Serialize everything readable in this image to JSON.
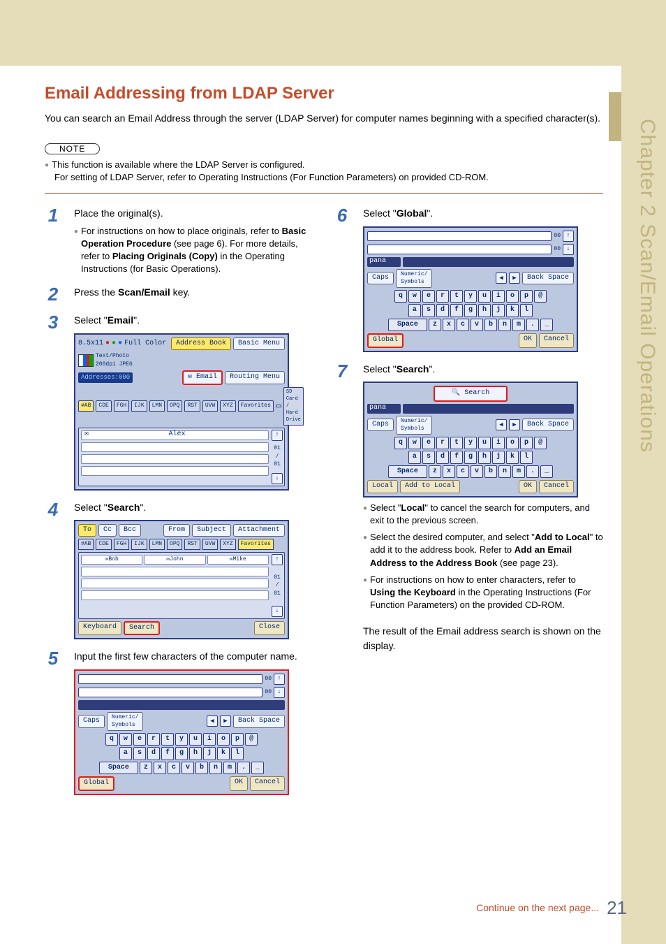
{
  "sidebar": {
    "chapter_label": "Chapter 2  Scan/Email Operations"
  },
  "header": {
    "title": "Email Addressing from LDAP Server",
    "intro": "You can search an Email Address through the server (LDAP Server) for computer names beginning with a specified character(s)."
  },
  "note": {
    "label": "NOTE",
    "items": [
      "This function is available where the LDAP Server is configured.",
      "For setting of LDAP Server, refer to Operating Instructions (For Function Parameters) on provided CD-ROM."
    ]
  },
  "steps": {
    "s1": {
      "text": "Place the original(s).",
      "sub": "For instructions on how to place originals, refer to ",
      "sub_b1": "Basic Operation Procedure",
      "sub_mid": " (see page 6). For more details, refer to ",
      "sub_b2": "Placing Originals (Copy)",
      "sub_end": " in the Operating Instructions (for Basic Operations)."
    },
    "s2": {
      "pre": "Press the ",
      "bold": "Scan/Email",
      "post": " key."
    },
    "s3": {
      "pre": "Select \"",
      "bold": "Email",
      "post": "\"."
    },
    "s4": {
      "pre": "Select \"",
      "bold": "Search",
      "post": "\"."
    },
    "s5": {
      "text": "Input the first few characters of the computer name."
    },
    "s6": {
      "pre": "Select \"",
      "bold": "Global",
      "post": "\"."
    },
    "s7": {
      "pre": "Select \"",
      "bold": "Search",
      "post": "\"."
    },
    "s7_subs": {
      "a_pre": "Select \"",
      "a_b": "Local",
      "a_post": "\" to cancel the search for computers, and exit to the previous screen.",
      "b_pre": "Select the desired computer, and select \"",
      "b_b": "Add to Local",
      "b_mid": "\" to add it to the address book. Refer to ",
      "b_b2": "Add an Email Address to the Address Book",
      "b_post": " (see page 23).",
      "c_pre": "For instructions on how to enter characters, refer to ",
      "c_b": "Using the Keyboard",
      "c_post": " in the Operating Instructions (For Function Parameters) on the provided CD-ROM."
    },
    "s7_result": "The result of the Email address search is shown on the display."
  },
  "ui": {
    "paper": "8.5x11",
    "color": "Full Color",
    "mode": "Text/Photo",
    "res": "200dpi JPEG",
    "addresses": "Addresses:000",
    "btn_addressbook": "Address Book",
    "btn_basicmenu": "Basic Menu",
    "btn_email": "Email",
    "btn_routing": "Routing Menu",
    "tabs": [
      "#AB",
      "CDE",
      "FGH",
      "IJK",
      "LMN",
      "OPQ",
      "RST",
      "UVW",
      "XYZ",
      "Favorites"
    ],
    "sdcard": "SD Card / Hard Drive",
    "name_alex": "Alex",
    "counter01": "01",
    "counterslash": "/",
    "counter01b": "01",
    "compose": {
      "to": "To",
      "cc": "Cc",
      "bcc": "Bcc",
      "from": "From",
      "subject": "Subject",
      "attach": "Attachment"
    },
    "names": {
      "bob": "Bob",
      "john": "John",
      "mike": "Mike"
    },
    "keyboard_btn": "Keyboard",
    "search_btn": "Search",
    "close_btn": "Close",
    "dblzero": "00",
    "keys_row1": [
      "q",
      "w",
      "e",
      "r",
      "t",
      "y",
      "u",
      "i",
      "o",
      "p",
      "@"
    ],
    "keys_row2": [
      "a",
      "s",
      "d",
      "f",
      "g",
      "h",
      "j",
      "k",
      "l"
    ],
    "keys_row3": [
      "z",
      "x",
      "c",
      "v",
      "b",
      "n",
      "m",
      ".",
      "_"
    ],
    "caps": "Caps",
    "numsym": "Numeric/\nSymbols",
    "backspace": "Back Space",
    "space": "Space",
    "global": "Global",
    "ok": "OK",
    "cancel": "Cancel",
    "local": "Local",
    "addlocal": "Add to Local",
    "pana": "pana"
  },
  "footer": {
    "continue": "Continue on the next page...",
    "page": "21"
  }
}
